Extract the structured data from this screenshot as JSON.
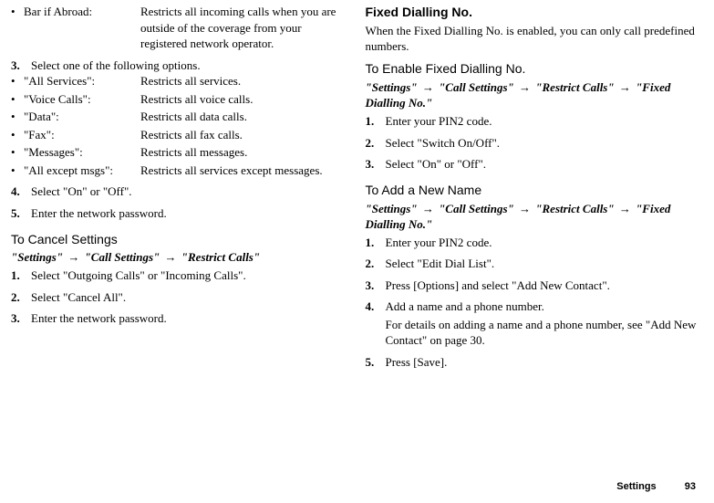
{
  "left": {
    "barIfAbroad": {
      "bullet": "•",
      "term": "Bar if Abroad:",
      "desc": "Restricts all incoming calls when you are outside of the coverage from your registered network operator."
    },
    "step3": {
      "num": "3.",
      "text": "Select one of the following options."
    },
    "options": [
      {
        "bullet": "•",
        "term": "\"All Services\":",
        "desc": "Restricts all services."
      },
      {
        "bullet": "•",
        "term": "\"Voice Calls\":",
        "desc": "Restricts all voice calls."
      },
      {
        "bullet": "•",
        "term": "\"Data\":",
        "desc": "Restricts all data calls."
      },
      {
        "bullet": "•",
        "term": "\"Fax\":",
        "desc": "Restricts all fax calls."
      },
      {
        "bullet": "•",
        "term": "\"Messages\":",
        "desc": "Restricts all messages."
      },
      {
        "bullet": "•",
        "term": "\"All except msgs\":",
        "desc": "Restricts all services except messages."
      }
    ],
    "step4": {
      "num": "4.",
      "text": "Select \"On\" or \"Off\"."
    },
    "step5": {
      "num": "5.",
      "text": "Enter the network password."
    },
    "cancelHeading": "To Cancel Settings",
    "cancelPath": {
      "p1": "\"Settings\"",
      "p2": "\"Call Settings\"",
      "p3": "\"Restrict Calls\""
    },
    "cancelSteps": [
      {
        "num": "1.",
        "text": "Select \"Outgoing Calls\" or \"Incoming Calls\"."
      },
      {
        "num": "2.",
        "text": "Select \"Cancel All\"."
      },
      {
        "num": "3.",
        "text": "Enter the network password."
      }
    ]
  },
  "right": {
    "fixedHeading": "Fixed Dialling No.",
    "fixedIntro": "When the Fixed Dialling No. is enabled, you can only call predefined numbers.",
    "enableHeading": "To Enable Fixed Dialling No.",
    "enablePath": {
      "p1": "\"Settings\"",
      "p2": "\"Call Settings\"",
      "p3": "\"Restrict Calls\"",
      "p4": "\"Fixed Dialling No.\""
    },
    "enableSteps": [
      {
        "num": "1.",
        "text": "Enter your PIN2 code."
      },
      {
        "num": "2.",
        "text": "Select \"Switch On/Off\"."
      },
      {
        "num": "3.",
        "text": "Select \"On\" or \"Off\"."
      }
    ],
    "addHeading": "To Add a New Name",
    "addPath": {
      "p1": "\"Settings\"",
      "p2": "\"Call Settings\"",
      "p3": "\"Restrict Calls\"",
      "p4": "\"Fixed Dialling No.\""
    },
    "addSteps": [
      {
        "num": "1.",
        "text": "Enter your PIN2 code."
      },
      {
        "num": "2.",
        "text": "Select \"Edit Dial List\"."
      },
      {
        "num": "3.",
        "text": "Press [Options] and select \"Add New Contact\"."
      },
      {
        "num": "4.",
        "text": "Add a name and a phone number.",
        "extra": "For details on adding a name and a phone number, see \"Add New Contact\" on page 30."
      },
      {
        "num": "5.",
        "text": "Press [Save]."
      }
    ]
  },
  "footer": {
    "label": "Settings",
    "page": "93"
  },
  "arrow": "→"
}
